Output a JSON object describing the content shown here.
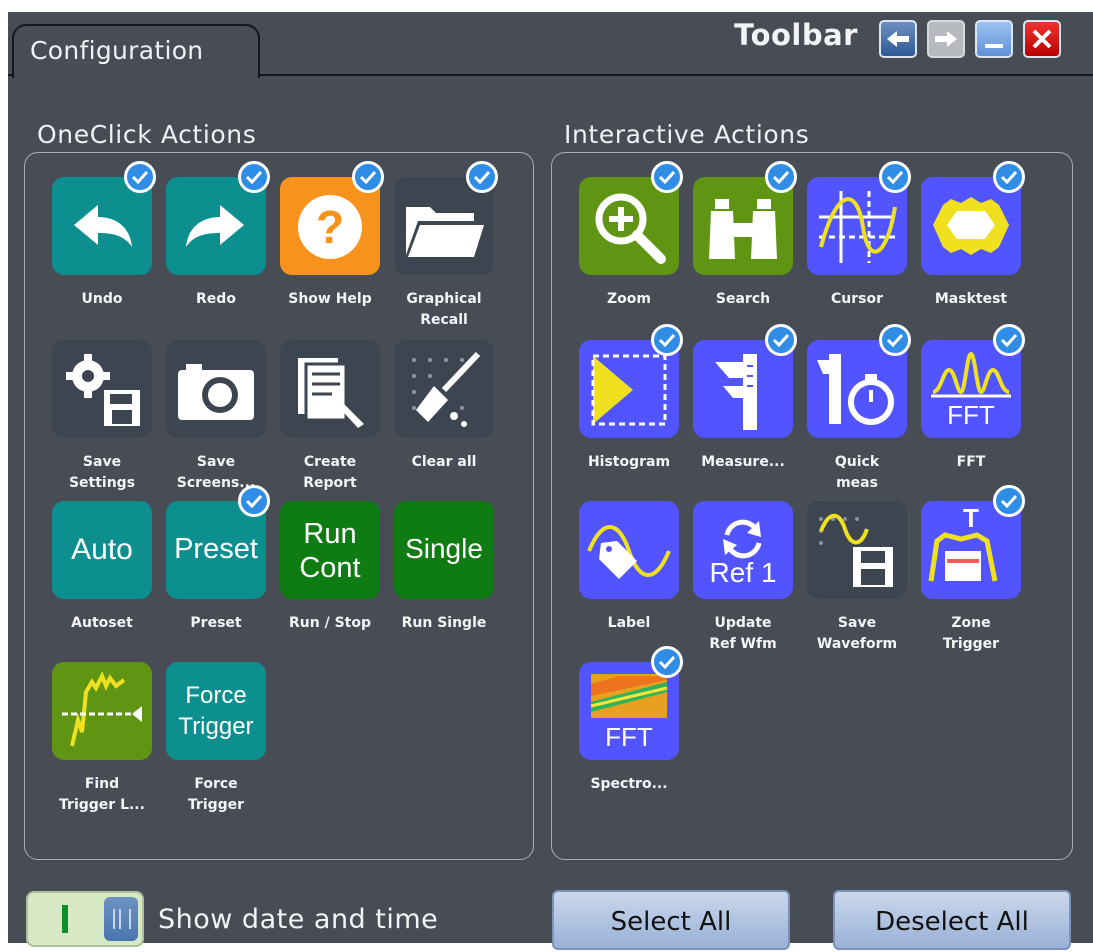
{
  "tab": {
    "label": "Configuration"
  },
  "toolbar": {
    "title": "Toolbar"
  },
  "oneclick": {
    "title": "OneClick Actions",
    "items": [
      {
        "label": "Undo"
      },
      {
        "label": "Redo"
      },
      {
        "label": "Show Help"
      },
      {
        "label": "Graphical\nRecall"
      },
      {
        "label": "Save\nSettings"
      },
      {
        "label": "Save\nScreens..."
      },
      {
        "label": "Create\nReport"
      },
      {
        "label": "Clear all"
      },
      {
        "label": "Autoset",
        "tile_text": "Auto"
      },
      {
        "label": "Preset",
        "tile_text": "Preset"
      },
      {
        "label": "Run / Stop",
        "tile_text": "Run\nCont"
      },
      {
        "label": "Run Single",
        "tile_text": "Single"
      },
      {
        "label": "Find\nTrigger L..."
      },
      {
        "label": "Force\nTrigger",
        "tile_text": "Force\nTrigger"
      }
    ]
  },
  "interactive": {
    "title": "Interactive Actions",
    "items": [
      {
        "label": "Zoom"
      },
      {
        "label": "Search"
      },
      {
        "label": "Cursor"
      },
      {
        "label": "Masktest"
      },
      {
        "label": "Histogram"
      },
      {
        "label": "Measure..."
      },
      {
        "label": "Quick\nmeas"
      },
      {
        "label": "FFT",
        "tile_text": "FFT"
      },
      {
        "label": "Label"
      },
      {
        "label": "Update\nRef Wfm",
        "tile_text": "Ref 1"
      },
      {
        "label": "Save\nWaveform"
      },
      {
        "label": "Zone\nTrigger",
        "tile_text": "T"
      },
      {
        "label": "Spectro...",
        "tile_text": "FFT"
      }
    ]
  },
  "footer": {
    "toggle_label": "Show date and time",
    "select_all": "Select All",
    "deselect_all": "Deselect All"
  },
  "colors": {
    "panel_bg": "#474c55",
    "teal": "#0e8f8f",
    "orange": "#f7931d",
    "slate": "#3d4650",
    "green": "#0f7c13",
    "lime": "#5f9512",
    "blue": "#5255ff",
    "check": "#2f8de6"
  }
}
